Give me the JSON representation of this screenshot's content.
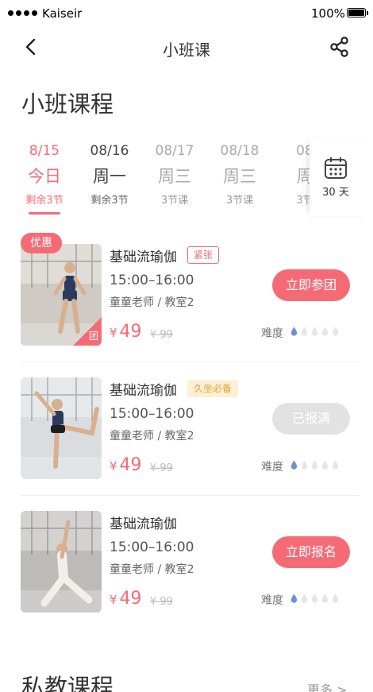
{
  "status_bar": {
    "carrier": "Kaiseir",
    "battery": "100%"
  },
  "nav": {
    "title": "小班课",
    "back_icon": "chevron-left-icon",
    "share_icon": "share-icon"
  },
  "section_title": "小班课程",
  "dates": [
    {
      "date": "8/15",
      "weekday": "今日",
      "count": "剩余3节",
      "state": "active"
    },
    {
      "date": "08/16",
      "weekday": "周一",
      "count": "剩余3节",
      "state": "selected"
    },
    {
      "date": "08/17",
      "weekday": "周三",
      "count": "3节课",
      "state": "normal"
    },
    {
      "date": "08/18",
      "weekday": "周三",
      "count": "3节课",
      "state": "normal"
    },
    {
      "date": "08",
      "weekday": "周",
      "count": "3节",
      "state": "normal"
    }
  ],
  "calendar": {
    "label": "30 天",
    "icon": "calendar-icon"
  },
  "courses": [
    {
      "name": "基础流瑜伽",
      "tag": "紧张",
      "tag_style": "red",
      "time": "15:00–16:00",
      "teacher": "童童老师 / 教室2",
      "price_symbol": "¥",
      "price": "49",
      "original_price": "¥ 99",
      "button": "立即参团",
      "button_state": "active",
      "promo": "优惠",
      "corner": "团",
      "difficulty_label": "难度",
      "difficulty": 1
    },
    {
      "name": "基础流瑜伽",
      "tag": "久坐必备",
      "tag_style": "yellow",
      "time": "15:00–16:00",
      "teacher": "童童老师 / 教室2",
      "price_symbol": "¥",
      "price": "49",
      "original_price": "¥ 99",
      "button": "已报满",
      "button_state": "disabled",
      "promo": "",
      "corner": "",
      "difficulty_label": "难度",
      "difficulty": 1
    },
    {
      "name": "基础流瑜伽",
      "tag": "",
      "tag_style": "",
      "time": "15:00–16:00",
      "teacher": "童童老师 / 教室2",
      "price_symbol": "¥",
      "price": "49",
      "original_price": "¥ 99",
      "button": "立即报名",
      "button_state": "active",
      "promo": "",
      "corner": "",
      "difficulty_label": "难度",
      "difficulty": 1
    }
  ],
  "section2": {
    "title": "私教课程",
    "more": "更多 >"
  },
  "colors": {
    "accent": "#f56b75",
    "drop_active": "#6e8fd6",
    "drop_inactive": "#e6e6e6"
  }
}
